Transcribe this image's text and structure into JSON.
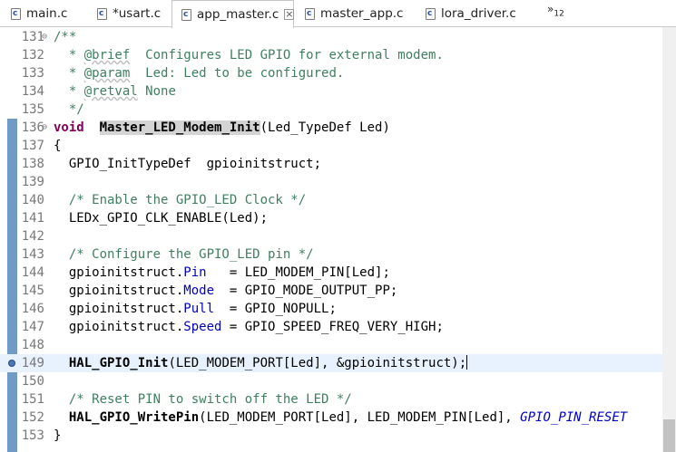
{
  "tabs": [
    {
      "label": "main.c",
      "active": false
    },
    {
      "label": "*usart.c",
      "active": false
    },
    {
      "label": "app_master.c",
      "active": true
    },
    {
      "label": "master_app.c",
      "active": false
    },
    {
      "label": "lora_driver.c",
      "active": false
    }
  ],
  "overflow": {
    "arrow": "»",
    "count": "12"
  },
  "editor": {
    "lines": [
      {
        "n": "131",
        "parts": [
          [
            "cm",
            "/**"
          ]
        ]
      },
      {
        "n": "132",
        "parts": [
          [
            "cm",
            "  * "
          ],
          [
            "cm tag",
            "@brief"
          ],
          [
            "cm",
            "  Configures LED GPIO for external modem."
          ]
        ]
      },
      {
        "n": "133",
        "parts": [
          [
            "cm",
            "  * "
          ],
          [
            "cm tag",
            "@param"
          ],
          [
            "cm",
            "  Led: Led to be configured."
          ]
        ]
      },
      {
        "n": "134",
        "parts": [
          [
            "cm",
            "  * "
          ],
          [
            "cm tag",
            "@retval"
          ],
          [
            "cm",
            " None"
          ]
        ]
      },
      {
        "n": "135",
        "parts": [
          [
            "cm",
            "  */"
          ]
        ]
      },
      {
        "n": "136",
        "parts": [
          [
            "kw",
            "void"
          ],
          [
            "",
            "  "
          ],
          [
            "fnh",
            "Master_LED_Modem_Init"
          ],
          [
            "",
            "(Led_TypeDef Led)"
          ]
        ]
      },
      {
        "n": "137",
        "parts": [
          [
            "",
            "{"
          ]
        ]
      },
      {
        "n": "138",
        "parts": [
          [
            "",
            "  GPIO_InitTypeDef  gpioinitstruct;"
          ]
        ]
      },
      {
        "n": "139",
        "parts": [
          [
            "",
            ""
          ]
        ]
      },
      {
        "n": "140",
        "parts": [
          [
            "cm",
            "  /* Enable the GPIO_LED Clock */"
          ]
        ]
      },
      {
        "n": "141",
        "parts": [
          [
            "",
            "  LEDx_GPIO_CLK_ENABLE(Led);"
          ]
        ]
      },
      {
        "n": "142",
        "parts": [
          [
            "",
            ""
          ]
        ]
      },
      {
        "n": "143",
        "parts": [
          [
            "cm",
            "  /* Configure the GPIO_LED pin */"
          ]
        ]
      },
      {
        "n": "144",
        "parts": [
          [
            "",
            "  gpioinitstruct."
          ],
          [
            "fld",
            "Pin"
          ],
          [
            "",
            "   = LED_MODEM_PIN[Led];"
          ]
        ]
      },
      {
        "n": "145",
        "parts": [
          [
            "",
            "  gpioinitstruct."
          ],
          [
            "fld",
            "Mode"
          ],
          [
            "",
            "  = GPIO_MODE_OUTPUT_PP;"
          ]
        ]
      },
      {
        "n": "146",
        "parts": [
          [
            "",
            "  gpioinitstruct."
          ],
          [
            "fld",
            "Pull"
          ],
          [
            "",
            "  = GPIO_NOPULL;"
          ]
        ]
      },
      {
        "n": "147",
        "parts": [
          [
            "",
            "  gpioinitstruct."
          ],
          [
            "fld",
            "Speed"
          ],
          [
            "",
            " = GPIO_SPEED_FREQ_VERY_HIGH;"
          ]
        ]
      },
      {
        "n": "148",
        "parts": [
          [
            "",
            ""
          ]
        ]
      },
      {
        "n": "149",
        "parts": [
          [
            "",
            "  "
          ],
          [
            "fn",
            "HAL_GPIO_Init"
          ],
          [
            "",
            "(LED_MODEM_PORT[Led], &gpioinitstruct);"
          ]
        ]
      },
      {
        "n": "150",
        "parts": [
          [
            "",
            ""
          ]
        ]
      },
      {
        "n": "151",
        "parts": [
          [
            "cm",
            "  /* Reset PIN to switch off the LED */"
          ]
        ]
      },
      {
        "n": "152",
        "parts": [
          [
            "",
            "  "
          ],
          [
            "fn",
            "HAL_GPIO_WritePin"
          ],
          [
            "",
            "(LED_MODEM_PORT[Led], LED_MODEM_PIN[Led], "
          ],
          [
            "ital",
            "GPIO_PIN_RESET"
          ]
        ]
      },
      {
        "n": "153",
        "parts": [
          [
            "",
            "}"
          ]
        ]
      }
    ]
  },
  "colors": {
    "comment": "#3f7f5f",
    "keyword": "#7f0055",
    "field": "#0000c0",
    "current_line": "#e8f2fe",
    "change_bar": "#6f9bc4"
  }
}
